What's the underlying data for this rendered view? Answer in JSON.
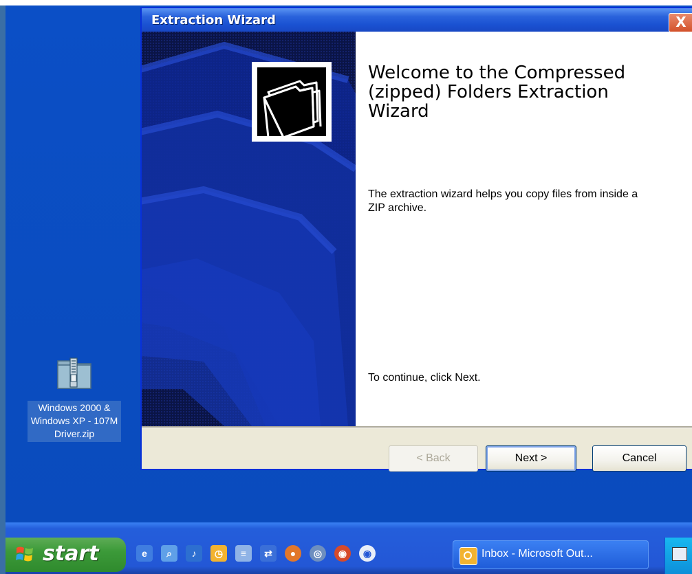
{
  "window": {
    "title": "Extraction Wizard",
    "close_label": "X",
    "heading": "Welcome to the Compressed (zipped) Folders Extraction Wizard",
    "description": "The extraction wizard helps you copy files from inside a ZIP archive.",
    "continue_text": "To continue, click Next.",
    "buttons": {
      "back": "< Back",
      "next": "Next >",
      "cancel": "Cancel"
    }
  },
  "desktop": {
    "icon": {
      "name": "zip-folder-icon",
      "label": "Windows 2000 & Windows XP - 107M Driver.zip"
    }
  },
  "taskbar": {
    "start_label": "start",
    "quick_launch": [
      "ie-icon",
      "search-icon",
      "media-icon",
      "outlook-icon",
      "notepad-icon",
      "transfer-icon",
      "firefox-icon",
      "network-icon",
      "media-player-icon",
      "disc-icon"
    ],
    "tasks": [
      {
        "label": "Inbox - Microsoft Out...",
        "icon": "outlook-icon"
      }
    ],
    "tray_icon": "tray-icon"
  },
  "colors": {
    "desktop": "#0b4fc6",
    "titlebar": "#2a63dc",
    "taskbar": "#245edb",
    "start": "#3c9a39",
    "left_panel": "#0a1446"
  }
}
